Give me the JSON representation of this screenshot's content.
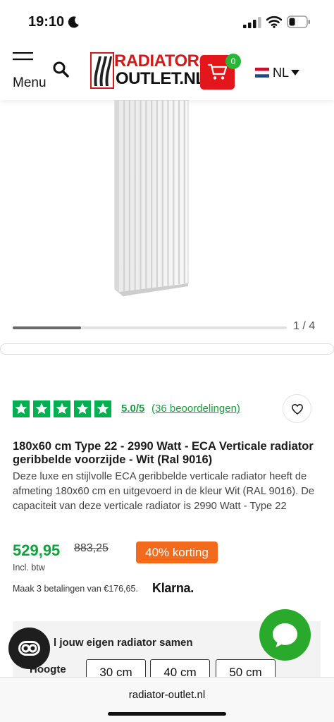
{
  "status_bar": {
    "time": "19:10",
    "moon_icon": "moon-icon",
    "signal_icon": "cellular-signal-icon",
    "wifi_icon": "wifi-icon",
    "battery_icon": "battery-icon",
    "battery_level": 0.35
  },
  "header": {
    "menu_label": "Menu",
    "search_icon": "search-icon",
    "logo_line1": "RADIATOR-",
    "logo_line2": "OUTLET.NL",
    "cart_icon": "cart-icon",
    "cart_count": "0",
    "language": "NL",
    "flag_icon": "netherlands-flag-icon",
    "brand_red": "#e3171b",
    "badge_green": "#28b636"
  },
  "gallery": {
    "counter": "1 / 4",
    "progress": 0.25
  },
  "product": {
    "stars": 5,
    "star_color": "#00b050",
    "rating_score": "5.0/5",
    "rating_count": "(36 beoordelingen)",
    "wishlist_icon": "heart-icon",
    "title": "180x60 cm Type 22 - 2990 Watt - ECA Verticale radiator geribbelde voorzijde - Wit (Ral 9016)",
    "description": "Deze luxe en stijlvolle ECA geribbelde verticale radiator heeft de afmeting 180x60 cm en uitgevoerd in de kleur Wit (RAL 9016). De capaciteit van deze verticale radiator is 2990 Watt - Type 22",
    "price": "529,95",
    "old_price": "883,25",
    "discount": "40% korting",
    "vat_note": "Incl. btw",
    "klarna_text": "Maak 3 betalingen van €176,65.",
    "klarna_logo": "Klarna."
  },
  "configurator": {
    "title": "l jouw eigen radiator samen",
    "height_label": "Hoogte",
    "sizes": [
      "30 cm",
      "40 cm",
      "50 cm"
    ]
  },
  "floating": {
    "left_icon": "accessibility-toggle-icon",
    "chat_icon": "chat-bubble-icon"
  },
  "browser": {
    "url": "radiator-outlet.nl"
  }
}
